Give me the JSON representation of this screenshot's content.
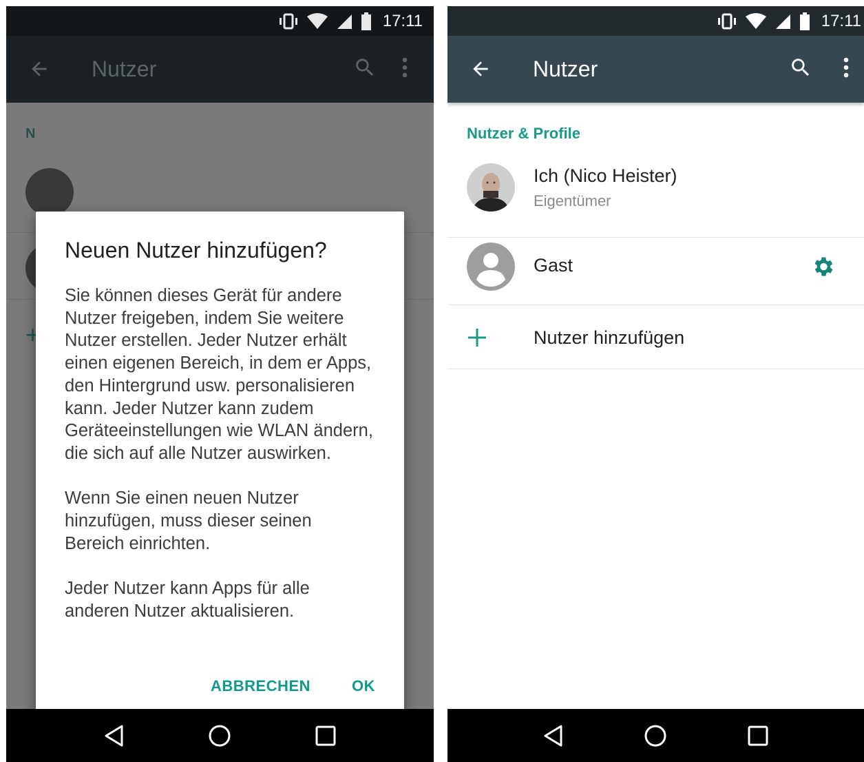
{
  "status": {
    "time": "17:11"
  },
  "left": {
    "appbar": {
      "title": "Nutzer"
    },
    "behind": {
      "header_initial": "N"
    },
    "dialog": {
      "title": "Neuen Nutzer hinzufügen?",
      "paragraphs": [
        "Sie können dieses Gerät für andere Nutzer freigeben, indem Sie weitere Nutzer erstellen. Jeder Nutzer erhält einen eigenen Bereich, in dem er Apps, den Hintergrund usw. personalisieren kann. Jeder Nutzer kann zudem Geräteeinstellungen wie WLAN ändern, die sich auf alle Nutzer auswirken.",
        "Wenn Sie einen neuen Nutzer hinzufügen, muss dieser seinen Bereich einrichten.",
        "Jeder Nutzer kann Apps für alle anderen Nutzer aktualisieren."
      ],
      "cancel_label": "ABBRECHEN",
      "ok_label": "OK"
    }
  },
  "right": {
    "appbar": {
      "title": "Nutzer"
    },
    "section_header": "Nutzer & Profile",
    "users": [
      {
        "name": "Ich (Nico Heister)",
        "role": "Eigentümer"
      },
      {
        "name": "Gast"
      }
    ],
    "add_user_label": "Nutzer hinzufügen"
  },
  "colors": {
    "accent": "#19998a",
    "appbar": "#37474f",
    "statusbar": "#222a2e"
  },
  "icons": [
    "vibrate-icon",
    "wifi-icon",
    "signal-icon",
    "battery-icon",
    "back-arrow-icon",
    "search-icon",
    "more-vert-icon",
    "gear-icon",
    "plus-icon",
    "nav-back-icon",
    "nav-home-icon",
    "nav-recents-icon"
  ]
}
